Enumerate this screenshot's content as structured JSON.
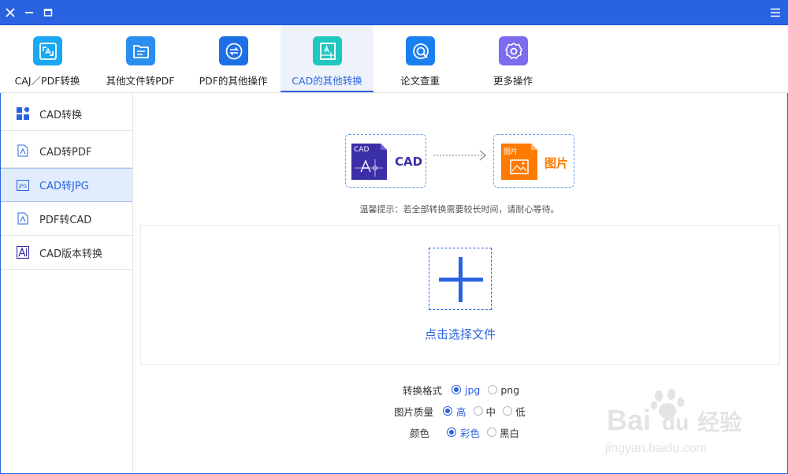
{
  "titlebar": {
    "close_icon": "close-icon",
    "minimize_icon": "minimize-icon",
    "maximize_icon": "maximize-icon",
    "menu_icon": "hamburger-menu-icon"
  },
  "toolbar": {
    "tabs": [
      {
        "label": "CAJ／PDF转换",
        "icon": "caj-pdf-convert-icon",
        "color": "#19a8f3"
      },
      {
        "label": "其他文件转PDF",
        "icon": "file-to-pdf-icon",
        "color": "#2a8df0"
      },
      {
        "label": "PDF的其他操作",
        "icon": "pdf-operations-icon",
        "color": "#1d6fe6"
      },
      {
        "label": "CAD的其他转换",
        "icon": "cad-convert-icon",
        "color": "#20c8c1",
        "active": true
      },
      {
        "label": "论文查重",
        "icon": "paper-check-icon",
        "color": "#1a7fef"
      },
      {
        "label": "更多操作",
        "icon": "more-settings-icon",
        "color": "#7b6cf0"
      }
    ]
  },
  "sidebar": {
    "items": [
      {
        "label": "CAD转换",
        "icon": "cad-convert-grid-icon"
      },
      {
        "label": "CAD转PDF",
        "icon": "pdf-file-icon"
      },
      {
        "label": "CAD转JPG",
        "icon": "jpg-file-icon",
        "active": true
      },
      {
        "label": "PDF转CAD",
        "icon": "pdf-file-icon"
      },
      {
        "label": "CAD版本转换",
        "icon": "cad-version-icon"
      }
    ]
  },
  "flow": {
    "source_badge": "CAD",
    "source_label": "CAD",
    "target_badge": "图片",
    "target_label": "图片",
    "source_color": "#3b2fa8",
    "target_color": "#ff7a00"
  },
  "hint": "温馨提示：若全部转换需要较长时间，请耐心等待。",
  "upload": {
    "choose_label": "点击选择文件"
  },
  "options": {
    "format": {
      "label": "转换格式",
      "choices": [
        "jpg",
        "png"
      ],
      "selected": "jpg"
    },
    "quality": {
      "label": "图片质量",
      "choices": [
        "高",
        "中",
        "低"
      ],
      "selected": "高"
    },
    "color": {
      "label": "颜色",
      "choices": [
        "彩色",
        "黑白"
      ],
      "selected": "彩色"
    }
  },
  "accent_color": "#2a63e2",
  "watermark": {
    "brand_text": "Bai",
    "brand_text2": "du",
    "brand_cn": "经验",
    "url": "jingyan.baidu.com"
  }
}
